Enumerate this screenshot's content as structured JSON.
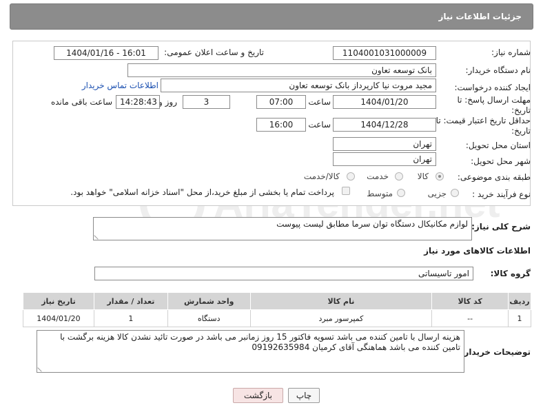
{
  "header": {
    "title": "جزئیات اطلاعات نیاز"
  },
  "fields": {
    "need_number_label": "شماره نیاز:",
    "need_number": "1104001031000009",
    "announce_label": "تاریخ و ساعت اعلان عمومی:",
    "announce_value": "1404/01/16 - 16:01",
    "buyer_org_label": "نام دستگاه خریدار:",
    "buyer_org": "بانک توسعه تعاون",
    "creator_label": "ایجاد کننده درخواست:",
    "creator": "مجید مروت نیا کارپرداز بانک توسعه تعاون",
    "contact_link": "اطلاعات تماس خریدار",
    "deadline_label": "مهلت ارسال پاسخ: تا تاریخ:",
    "deadline_date": "1404/01/20",
    "time_label": "ساعت",
    "deadline_time": "07:00",
    "days_value": "3",
    "days_label": "روز و",
    "remaining_time": "14:28:43",
    "remaining_label": "ساعت باقی مانده",
    "validity_label": "حداقل تاریخ اعتبار قیمت: تا تاریخ:",
    "validity_date": "1404/12/28",
    "validity_time": "16:00",
    "province_label": "استان محل تحویل:",
    "province": "تهران",
    "city_label": "شهر محل تحویل:",
    "city": "تهران",
    "category_label": "طبقه بندی موضوعی:",
    "category_options": [
      "کالا",
      "خدمت",
      "کالا/خدمت"
    ],
    "process_label": "نوع فرآیند خرید :",
    "process_options": [
      "جزیی",
      "متوسط"
    ],
    "payment_note": "پرداخت تمام یا بخشی از مبلغ خرید،از محل \"اسناد خزانه اسلامی\" خواهد بود."
  },
  "description": {
    "label": "شرح کلی نیاز:",
    "value": "لوازم مکانیکال دستگاه توان سرما مطابق لیست پیوست"
  },
  "goods": {
    "section_title": "اطلاعات کالاهای مورد نیاز",
    "group_label": "گروه کالا:",
    "group_value": "امور تاسیساتی",
    "columns": [
      "ردیف",
      "کد کالا",
      "نام کالا",
      "واحد شمارش",
      "تعداد / مقدار",
      "تاریخ نیاز"
    ],
    "rows": [
      [
        "1",
        "--",
        "کمپرسور مبرد",
        "دستگاه",
        "1",
        "1404/01/20"
      ]
    ]
  },
  "buyer_notes": {
    "label": "توضیحات خریدار:",
    "value": "هزینه ارسال با تامین کننده می باشد تسویه فاکتور 15 روز زمانبر می باشد در صورت تائید نشدن کالا هزینه برگشت با تامین کننده می باشد هماهنگی آقای کرمیان 09192635984"
  },
  "buttons": {
    "print": "چاپ",
    "back": "بازگشت"
  },
  "watermark": {
    "text": "AriaTender.net"
  }
}
